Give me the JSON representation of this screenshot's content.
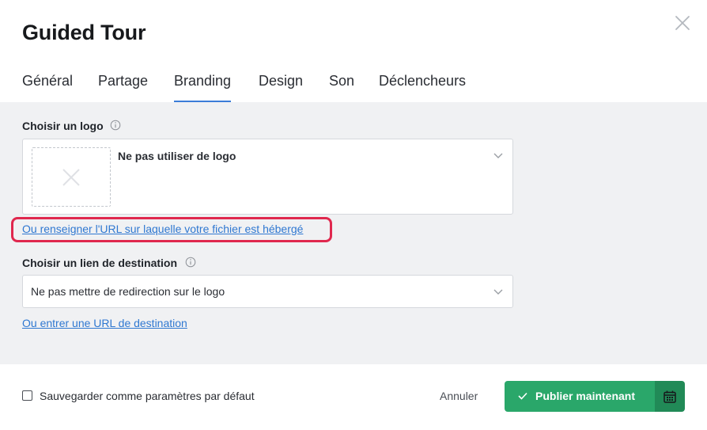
{
  "modal": {
    "title": "Guided Tour"
  },
  "tabs": [
    {
      "label": "Général",
      "active": false
    },
    {
      "label": "Partage",
      "active": false
    },
    {
      "label": "Branding",
      "active": true
    },
    {
      "label": "Design",
      "active": false
    },
    {
      "label": "Son",
      "active": false
    },
    {
      "label": "Déclencheurs",
      "active": false
    }
  ],
  "branding": {
    "logo": {
      "label": "Choisir un logo",
      "selected": "Ne pas utiliser de logo",
      "url_link": "Ou renseigner l'URL sur laquelle votre fichier est hébergé"
    },
    "destination": {
      "label": "Choisir un lien de destination",
      "selected": "Ne pas mettre de redirection sur le logo",
      "url_link": "Ou entrer une URL de destination"
    }
  },
  "footer": {
    "save_default_label": "Sauvegarder comme paramètres par défaut",
    "save_default_checked": false,
    "cancel_label": "Annuler",
    "publish_label": "Publier maintenant"
  },
  "icons": {
    "close": "close-icon",
    "info": "info-icon",
    "chevron": "chevron-down-icon",
    "no-image": "no-image-icon",
    "check": "check-icon",
    "calendar": "calendar-icon"
  },
  "colors": {
    "accent": "#3b7dd8",
    "link": "#2f78d1",
    "highlight": "#e0284e",
    "publish": "#2aa76a",
    "publish_dark": "#218a57",
    "panel_bg": "#f0f1f3"
  }
}
